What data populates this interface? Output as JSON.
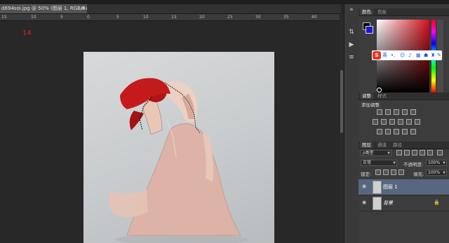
{
  "document": {
    "tab_title": "d694soi.jpg @ 50% (图层 1, RGB/8#) *",
    "close_symbol": "✕",
    "ruler_marks": [
      "15",
      "10",
      "5",
      "0",
      "5",
      "10",
      "15",
      "20",
      "25",
      "30",
      "35",
      "40"
    ],
    "annotation": "14"
  },
  "panels": {
    "color": {
      "tab_active": "颜色",
      "tab_inactive": "色板",
      "foreground": "#050505",
      "background": "#1a18d8"
    },
    "adjustments": {
      "tab_active": "调整",
      "tab_inactive": "样式",
      "title": "添加调整"
    },
    "layers": {
      "tabs": [
        "图层",
        "通道",
        "路径"
      ],
      "filter_kind": "ρ类型",
      "blend_mode": "正常",
      "opacity_label": "不透明度:",
      "opacity_value": "100%",
      "lock_label": "锁定:",
      "fill_label": "填充:",
      "fill_value": "100%",
      "items": [
        {
          "name": "图层 1",
          "selected": true
        },
        {
          "name": "背景",
          "locked": true
        }
      ]
    }
  },
  "ime_toolbar": {
    "brand": "S",
    "mode": "英",
    "icons": [
      "punctuation-icon",
      "emoji-icon",
      "mic-icon",
      "keyboard-icon",
      "user-icon",
      "shirt-icon",
      "wrench-icon"
    ]
  },
  "tool_icons": [
    "expand-icon",
    "history-icon",
    "actions-icon",
    "settings-icon"
  ]
}
